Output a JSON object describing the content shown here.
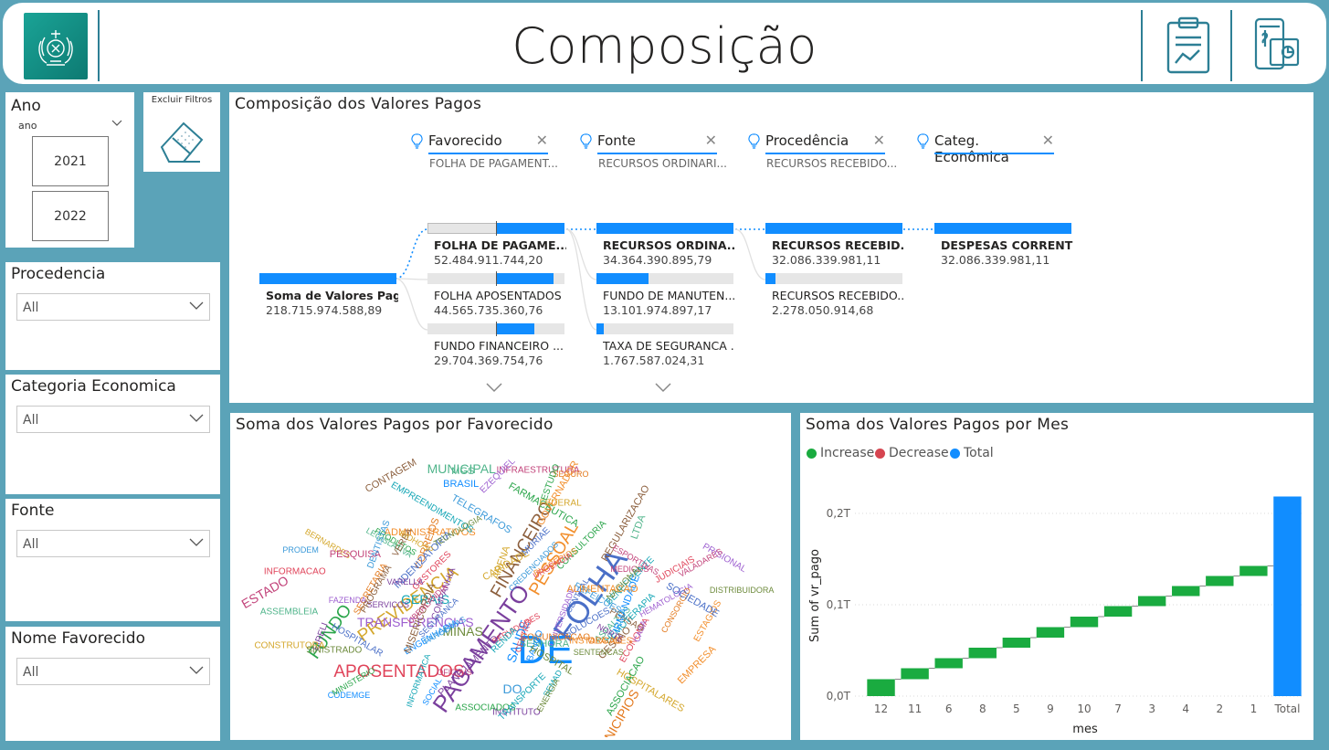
{
  "header": {
    "title": "Composição"
  },
  "filters": {
    "ano": {
      "label": "Ano",
      "field": "ano",
      "years": [
        "2021",
        "2022"
      ]
    },
    "excluir": {
      "label": "Excluir Filtros"
    },
    "procedencia": {
      "label": "Procedencia",
      "value": "All"
    },
    "categoria": {
      "label": "Categoria Economica",
      "value": "All"
    },
    "fonte": {
      "label": "Fonte",
      "value": "All"
    },
    "favorecido": {
      "label": "Nome Favorecido",
      "value": "All"
    }
  },
  "decomp": {
    "title": "Composição dos Valores Pagos",
    "levels": [
      {
        "name": "Favorecido",
        "selected": "FOLHA DE PAGAMENT..."
      },
      {
        "name": "Fonte",
        "selected": "RECURSOS ORDINARI..."
      },
      {
        "name": "Procedência",
        "selected": "RECURSOS RECEBIDO..."
      },
      {
        "name": "Categ. Econômica",
        "selected": ""
      }
    ],
    "root": {
      "label": "Soma de Valores Pagos",
      "value": "218.715.974.588,89"
    },
    "col1": [
      {
        "label": "FOLHA DE PAGAME...",
        "value": "52.484.911.744,20",
        "share": 0.5
      },
      {
        "label": "FOLHA APOSENTADOS",
        "value": "44.565.735.360,76",
        "share": 0.42
      },
      {
        "label": "FUNDO FINANCEIRO ...",
        "value": "29.704.369.754,76",
        "share": 0.28
      }
    ],
    "col2": [
      {
        "label": "RECURSOS ORDINA...",
        "value": "34.364.390.895,79",
        "share": 1.0
      },
      {
        "label": "FUNDO DE MANUTEN...",
        "value": "13.101.974.897,17",
        "share": 0.38
      },
      {
        "label": "TAXA DE SEGURANCA ...",
        "value": "1.767.587.024,31",
        "share": 0.05
      }
    ],
    "col3": [
      {
        "label": "RECURSOS RECEBID...",
        "value": "32.086.339.981,11",
        "share": 1.0
      },
      {
        "label": "RECURSOS RECEBIDO...",
        "value": "2.278.050.914,68",
        "share": 0.07
      }
    ],
    "col4": [
      {
        "label": "DESPESAS CORRENTES",
        "value": "32.086.339.981,11",
        "share": 1.0
      }
    ]
  },
  "wordcloud": {
    "title": "Soma dos Valores Pagos por Favorecido",
    "words": [
      "DE",
      "FOLHA",
      "PAGAMENTO",
      "APOSENTADOS",
      "PESSOAL",
      "FUNDO",
      "PREVIDENCIA",
      "FINANCEIRO",
      "GERAIS",
      "ESTADO",
      "MINAS",
      "DO",
      "MUNICIPIOS",
      "TRANSFERENCIAS",
      "MUNICIPAL",
      "SAUDE",
      "HOSPITALAR",
      "INSTITUTO",
      "SERVIDORES",
      "ADMINISTRATIVOS",
      "CONSULTORIA",
      "HOSPITALARES",
      "REGULARIZACAO",
      "INFORMATICA",
      "MEDICOS",
      "DISTRIBUIDORA",
      "CREDENCIADOS",
      "CORREIOS",
      "UNIVERSIDADE",
      "SENHORA",
      "SOCIAL",
      "CENTRAL",
      "EIRELI",
      "JUDICIAIS",
      "BLOGERIOS",
      "PRODUTOS",
      "CONSTRUTORA",
      "CONTAGEM",
      "EMPREENDIMENTOS",
      "INFRAESTRUTURA",
      "SINISTRADO",
      "TELEGRAFOS",
      "COMUNICACAO",
      "HEMATOLOGIA",
      "LEGISLATIVA",
      "ENGENHARIA",
      "INDENIZATORIA",
      "COMPANHIA",
      "GESTORES",
      "ESTAGIOS",
      "ASSOCIADOS",
      "BERNARDES",
      "MISERICORDIA",
      "BENEFICENTE",
      "PESQUISA",
      "TECNOLOGIA",
      "DENTISTAS",
      "SECRETARIA",
      "PRISIONAL",
      "ASFALTOS",
      "CODEMGE",
      "SOLUCOES",
      "VARELLA",
      "ECONOMIA",
      "INSTALACOES",
      "FARMACEUTICA",
      "CARIDADE",
      "PENSAO",
      "HEMOTERAPIA",
      "OFICIAIS",
      "NACIONAL",
      "PARCERIAS",
      "SEGURO",
      "EZEQUIEL",
      "ASSEMBLEIA",
      "BANCO",
      "SEGURANCA",
      "SERVICOS",
      "INFORMACAO",
      "EMPRESA",
      "MINISTERIO",
      "FEDERAL",
      "VERBA",
      "TRANSPORTE",
      "VALADARES",
      "HOSPITAL",
      "REFEICOES",
      "CONSORCIO",
      "FAZENDA",
      "MGS",
      "IRMANDADE",
      "MURIAE",
      "PLANEJAMENTO",
      "URGENCIA",
      "ALIMENTACAO",
      "ESTUDO",
      "ARENA",
      "GESTAO",
      "RENDA",
      "UBERLANDIA",
      "SENTENCAS",
      "PRODEM",
      "ORGAO",
      "CASA",
      "LTDA",
      "BRASIL",
      "SOCIEDADE",
      "NORTE",
      "CENTRO",
      "GOVERNADOR",
      "ASSOCIACAO",
      "BIOHOSP",
      "PROGRAMA",
      "SEMAD",
      "ESPORTIVAS",
      "ENERGIA"
    ],
    "colors": [
      "#118dff",
      "#4a6fc7",
      "#7a3f9d",
      "#e0445a",
      "#f28e2b",
      "#2aa54a",
      "#d4a72c",
      "#8b5e3c",
      "#12a5b5",
      "#c2437a",
      "#6e8b3d",
      "#3b9ad9",
      "#e37a1f",
      "#9d5fd0",
      "#4fb48a"
    ]
  },
  "waterfall": {
    "title": "Soma dos Valores Pagos por Mes",
    "legend": [
      {
        "label": "Increase",
        "color": "#1aab40"
      },
      {
        "label": "Decrease",
        "color": "#d64550"
      },
      {
        "label": "Total",
        "color": "#118dff"
      }
    ]
  },
  "chart_data": {
    "type": "bar",
    "subtype": "waterfall",
    "title": "Soma dos Valores Pagos por Mes",
    "xlabel": "mes",
    "ylabel": "Sum of vr_pago",
    "categories": [
      "12",
      "11",
      "6",
      "8",
      "5",
      "9",
      "10",
      "7",
      "3",
      "4",
      "2",
      "1",
      "Total"
    ],
    "values": [
      0.0185,
      0.012,
      0.011,
      0.0115,
      0.011,
      0.0115,
      0.0115,
      0.0115,
      0.011,
      0.011,
      0.011,
      0.011,
      0.2185
    ],
    "y_ticks": [
      "0,0T",
      "0,1T",
      "0,2T"
    ],
    "ylim": [
      0,
      0.22
    ],
    "grid": true,
    "legend_position": "top-left"
  }
}
